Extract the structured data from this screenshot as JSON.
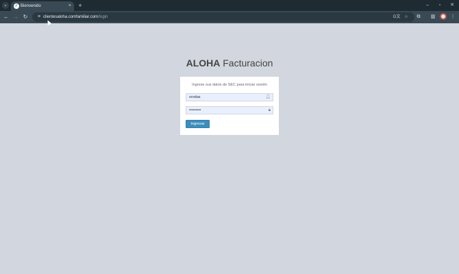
{
  "browser": {
    "tab_title": "Bienvenido",
    "tab_close": "×",
    "new_tab": "+",
    "url_host": "clientesaloha.comfamiliar.com",
    "url_path": "/login",
    "window_controls": {
      "minimize": "–",
      "maximize": "▫",
      "close": "✕"
    },
    "icons": {
      "back": "arrow-left-icon",
      "forward": "arrow-right-icon",
      "reload": "reload-icon",
      "site_info": "tune-icon",
      "translate": "translate-icon",
      "bookmark": "star-icon",
      "extensions": "puzzle-icon",
      "side_panel": "side-panel-icon",
      "menu": "kebab-menu-icon"
    }
  },
  "page": {
    "logo_bold": "ALOHA",
    "logo_light": "Facturacion",
    "login_message": "Ingrese sus datos de SEC para iniciar sesión",
    "username": {
      "value": "srodas",
      "icon": "user-icon"
    },
    "password": {
      "value": "•••••••••",
      "icon": "lock-icon"
    },
    "submit_label": "Ingresar"
  },
  "colors": {
    "page_bg": "#d2d6de",
    "tabbar_bg": "#1f2b33",
    "toolbar_bg": "#3a4a55",
    "button_primary": "#3c8dbc",
    "input_autofill_bg": "#e8f0fe"
  }
}
